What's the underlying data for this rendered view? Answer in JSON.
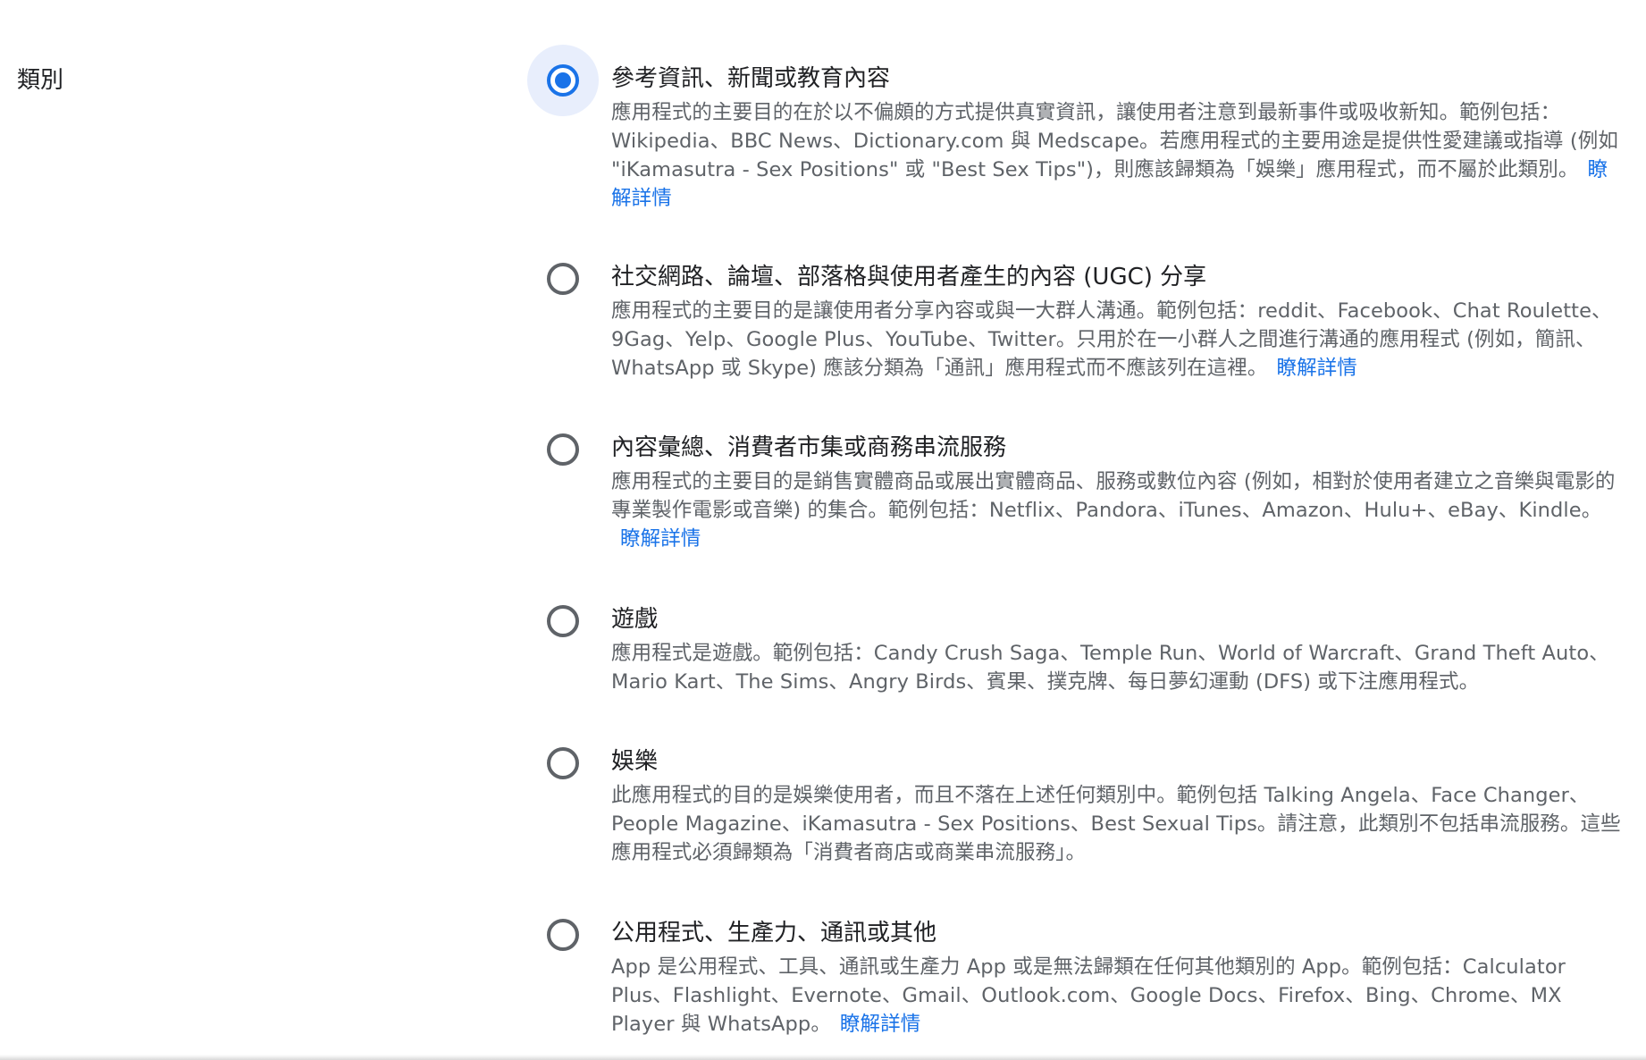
{
  "section": {
    "label": "類別"
  },
  "options": [
    {
      "title": "參考資訊、新聞或教育內容",
      "description": "應用程式的主要目的在於以不偏頗的方式提供真實資訊，讓使用者注意到最新事件或吸收新知。範例包括：Wikipedia、BBC News、Dictionary.com 與 Medscape。若應用程式的主要用途是提供性愛建議或指導 (例如 \"iKamasutra - Sex Positions\" 或 \"Best Sex Tips\")，則應該歸類為「娛樂」應用程式，而不屬於此類別。",
      "link": "瞭解詳情",
      "selected": true
    },
    {
      "title": "社交網路、論壇、部落格與使用者產生的內容 (UGC) 分享",
      "description": "應用程式的主要目的是讓使用者分享內容或與一大群人溝通。範例包括：reddit、Facebook、Chat Roulette、9Gag、Yelp、Google Plus、YouTube、Twitter。只用於在一小群人之間進行溝通的應用程式 (例如，簡訊、WhatsApp 或 Skype) 應該分類為「通訊」應用程式而不應該列在這裡。",
      "link": "瞭解詳情",
      "selected": false
    },
    {
      "title": "內容彙總、消費者市集或商務串流服務",
      "description": "應用程式的主要目的是銷售實體商品或展出實體商品、服務或數位內容 (例如，相對於使用者建立之音樂與電影的專業製作電影或音樂) 的集合。範例包括：Netflix、Pandora、iTunes、Amazon、Hulu+、eBay、Kindle。",
      "link": "瞭解詳情",
      "selected": false
    },
    {
      "title": "遊戲",
      "description": "應用程式是遊戲。範例包括：Candy Crush Saga、Temple Run、World of Warcraft、Grand Theft Auto、Mario Kart、The Sims、Angry Birds、賓果、撲克牌、每日夢幻運動 (DFS) 或下注應用程式。",
      "link": "",
      "selected": false
    },
    {
      "title": "娛樂",
      "description": "此應用程式的目的是娛樂使用者，而且不落在上述任何類別中。範例包括 Talking Angela、Face Changer、People Magazine、iKamasutra - Sex Positions、Best Sexual Tips。請注意，此類別不包括串流服務。這些應用程式必須歸類為「消費者商店或商業串流服務」。",
      "link": "",
      "selected": false
    },
    {
      "title": "公用程式、生產力、通訊或其他",
      "description": "App 是公用程式、工具、通訊或生產力 App 或是無法歸類在任何其他類別的 App。範例包括：Calculator Plus、Flashlight、Evernote、Gmail、Outlook.com、Google Docs、Firefox、Bing、Chrome、MX Player 與 WhatsApp。",
      "link": "瞭解詳情",
      "selected": false
    }
  ],
  "colors": {
    "accent": "#1a73e8",
    "focus_ring": "#e8eefc",
    "radio_border": "#5f6368",
    "title_text": "#202124",
    "desc_text": "#5f6368"
  }
}
